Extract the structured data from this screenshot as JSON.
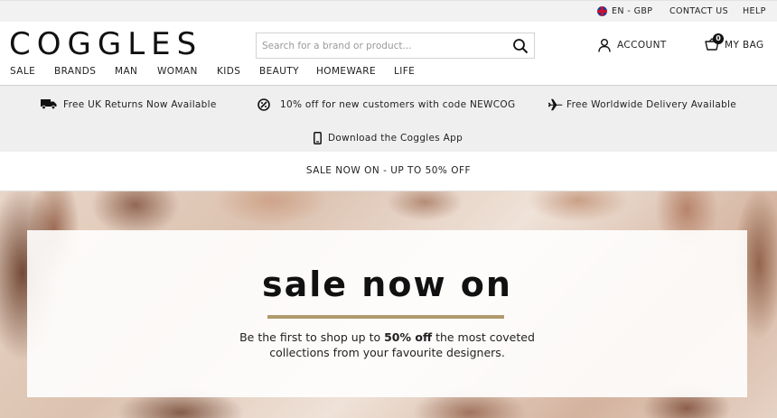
{
  "topbar": {
    "locale": "EN - GBP",
    "contact": "CONTACT US",
    "help": "HELP"
  },
  "header": {
    "logo": "COGGLES",
    "search": {
      "placeholder": "Search for a brand or product..."
    },
    "account_label": "ACCOUNT",
    "bag_label": "MY BAG",
    "bag_count": "0"
  },
  "nav": {
    "items": [
      "SALE",
      "BRANDS",
      "MAN",
      "WOMAN",
      "KIDS",
      "BEAUTY",
      "HOMEWARE",
      "LIFE"
    ]
  },
  "promo": {
    "returns": "Free UK Returns Now Available",
    "discount": "10% off for new customers with code NEWCOG",
    "delivery": "Free Worldwide Delivery Available",
    "app": "Download the Coggles App"
  },
  "sale_banner": "SALE NOW ON - UP TO 50% OFF",
  "hero": {
    "title": "sale now on",
    "line1_pre": "Be the first to shop up to ",
    "line1_bold": "50% off",
    "line1_post": " the most coveted",
    "line2": "collections from your favourite designers."
  },
  "colors": {
    "accent_rule": "#b09a6e",
    "promo_bg": "#efefef",
    "utility_bg": "#f2f2f2"
  },
  "icons": [
    "uk-flag-icon",
    "search-icon",
    "account-icon",
    "bag-icon",
    "truck-icon",
    "discount-icon",
    "plane-icon",
    "phone-icon"
  ]
}
